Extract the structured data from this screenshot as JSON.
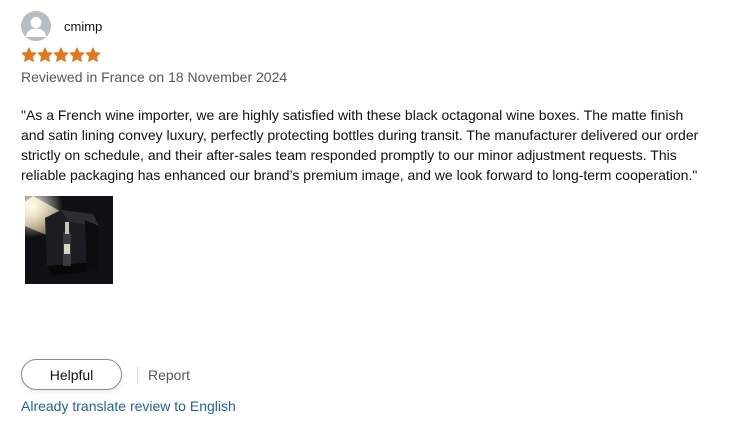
{
  "review": {
    "profile_name": "cmimp",
    "rating": 5,
    "rating_max": 5,
    "date_line": "Reviewed in France on 18 November 2024",
    "body": "\"As a French wine importer, we are highly satisfied with these black octagonal wine boxes. The matte finish and satin lining convey luxury, perfectly protecting bottles during transit. The manufacturer delivered our order strictly on schedule, and their after-sales team responded promptly to our minor adjustment requests. This reliable packaging has enhanced our brand’s premium image, and we look forward to long-term cooperation.\"",
    "image_icon": "review-photo-wine-box"
  },
  "actions": {
    "helpful_label": "Helpful",
    "report_label": "Report"
  },
  "translate": {
    "link_text": "Already translate review to English"
  },
  "colors": {
    "star": "#de7921",
    "link": "#2162a1",
    "muted_text": "#565959",
    "text": "#0f1111",
    "avatar_bg": "#b8bdc2"
  }
}
